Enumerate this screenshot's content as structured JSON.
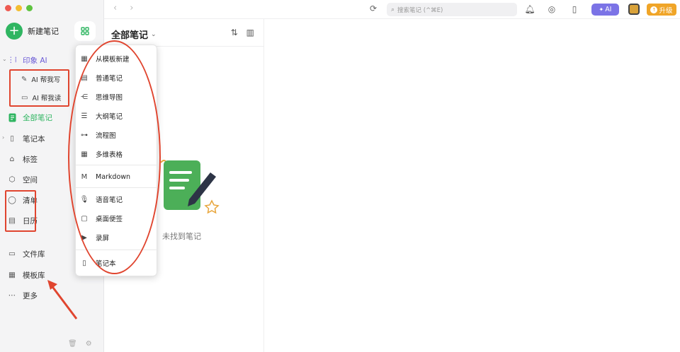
{
  "sidebar": {
    "new_note_label": "新建笔记",
    "ai_section_label": "印象 AI",
    "ai_write_label": "AI 帮我写",
    "ai_read_label": "AI 帮我读",
    "items": {
      "all_notes": "全部笔记",
      "notebooks": "笔记本",
      "tags": "标签",
      "spaces": "空间",
      "checklist": "清单",
      "calendar": "日历",
      "files": "文件库",
      "templates": "模板库",
      "more": "更多"
    }
  },
  "toolbar": {
    "search_placeholder": "搜索笔记 (^⌘E)",
    "ai_label": "AI",
    "upgrade_label": "升级"
  },
  "list": {
    "title": "全部笔记",
    "empty_text": "未找到笔记"
  },
  "menu": {
    "from_template": "从模板新建",
    "normal_note": "普通笔记",
    "mind_map": "思维导图",
    "outline_note": "大纲笔记",
    "flowchart": "流程图",
    "multi_table": "多维表格",
    "markdown": "Markdown",
    "voice_note": "语音笔记",
    "sticky": "桌面便签",
    "screen_record": "录屏",
    "notebook": "笔记本"
  },
  "colors": {
    "accent_green": "#2fb561",
    "ai_purple": "#7b73e6",
    "upgrade_orange": "#f0a528",
    "annotation_red": "#e0452f"
  }
}
